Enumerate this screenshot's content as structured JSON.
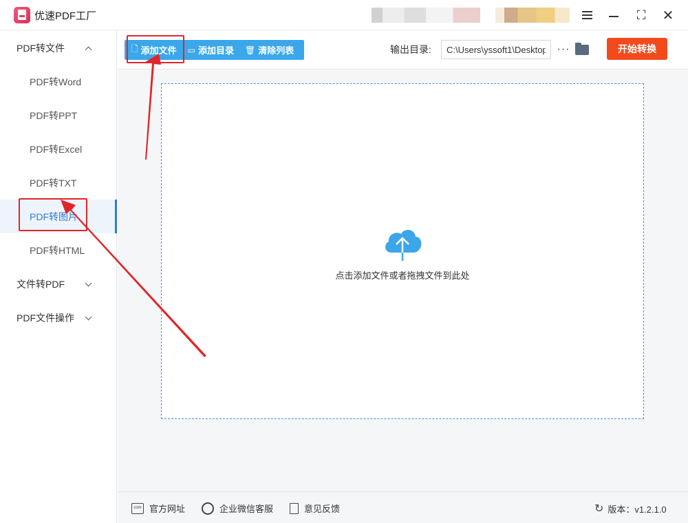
{
  "app": {
    "title": "优速PDF工厂"
  },
  "window": {
    "maximize_glyph": "⛶",
    "close_glyph": "✕"
  },
  "sidebar": {
    "groups": [
      {
        "label": "PDF转文件",
        "expanded": true
      },
      {
        "label": "文件转PDF",
        "expanded": false
      },
      {
        "label": "PDF文件操作",
        "expanded": false
      }
    ],
    "items": [
      {
        "label": "PDF转Word"
      },
      {
        "label": "PDF转PPT"
      },
      {
        "label": "PDF转Excel"
      },
      {
        "label": "PDF转TXT"
      },
      {
        "label": "PDF转图片",
        "active": true
      },
      {
        "label": "PDF转HTML"
      }
    ]
  },
  "toolbar": {
    "add_file": "添加文件",
    "add_folder": "添加目录",
    "clear_list": "清除列表",
    "output_label": "输出目录:",
    "output_path": "C:\\Users\\yssoft1\\Desktop",
    "more": "···",
    "start": "开始转换"
  },
  "dropzone": {
    "hint": "点击添加文件或者拖拽文件到此处"
  },
  "footer": {
    "website": "官方网址",
    "wechat": "企业微信客服",
    "feedback": "意见反馈",
    "version": "版本：v1.2.1.0"
  },
  "colors": {
    "accent": "#3ba7ea",
    "start": "#f24a1d",
    "annotation": "#e0262b"
  }
}
